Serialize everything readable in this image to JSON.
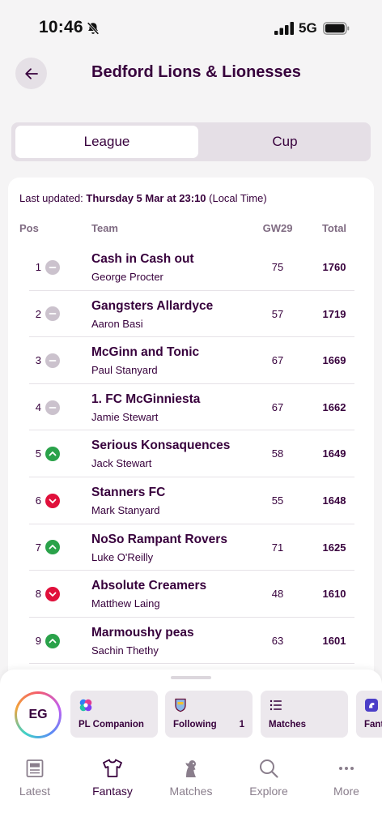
{
  "status_bar": {
    "time": "10:46",
    "network": "5G"
  },
  "header": {
    "title": "Bedford Lions & Lionesses"
  },
  "segment": {
    "league_label": "League",
    "cup_label": "Cup",
    "selected": "League"
  },
  "updated": {
    "prefix": "Last updated: ",
    "datetime": "Thursday 5 Mar at 23:10",
    "suffix": " (Local Time)"
  },
  "table": {
    "columns": {
      "pos": "Pos",
      "team": "Team",
      "gw": "GW29",
      "total": "Total"
    },
    "rows": [
      {
        "pos": "1",
        "movement": "same",
        "team": "Cash in Cash out",
        "manager": "George Procter",
        "gw": "75",
        "total": "1760"
      },
      {
        "pos": "2",
        "movement": "same",
        "team": "Gangsters Allardyce",
        "manager": "Aaron Basi",
        "gw": "57",
        "total": "1719"
      },
      {
        "pos": "3",
        "movement": "same",
        "team": "McGinn and Tonic",
        "manager": "Paul Stanyard",
        "gw": "67",
        "total": "1669"
      },
      {
        "pos": "4",
        "movement": "same",
        "team": "1. FC McGinniesta",
        "manager": "Jamie Stewart",
        "gw": "67",
        "total": "1662"
      },
      {
        "pos": "5",
        "movement": "up",
        "team": "Serious Konsaquences",
        "manager": "Jack Stewart",
        "gw": "58",
        "total": "1649"
      },
      {
        "pos": "6",
        "movement": "down",
        "team": "Stanners FC",
        "manager": "Mark Stanyard",
        "gw": "55",
        "total": "1648"
      },
      {
        "pos": "7",
        "movement": "up",
        "team": "NoSo Rampant Rovers",
        "manager": "Luke O'Reilly",
        "gw": "71",
        "total": "1625"
      },
      {
        "pos": "8",
        "movement": "down",
        "team": "Absolute Creamers",
        "manager": "Matthew Laing",
        "gw": "48",
        "total": "1610"
      },
      {
        "pos": "9",
        "movement": "up",
        "team": "Marmoushy peas",
        "manager": "Sachin Thethy",
        "gw": "63",
        "total": "1601"
      }
    ]
  },
  "drawer": {
    "avatar_initials": "EG",
    "cards": [
      {
        "label": "PL Companion",
        "icon": "pl-companion-icon",
        "badge": ""
      },
      {
        "label": "Following",
        "icon": "club-crest-icon",
        "badge": "1"
      },
      {
        "label": "Matches",
        "icon": "list-icon",
        "badge": ""
      },
      {
        "label": "Fant",
        "icon": "fantasy-icon",
        "badge": ""
      }
    ]
  },
  "tabbar": {
    "items": [
      {
        "label": "Latest",
        "icon": "newspaper-icon"
      },
      {
        "label": "Fantasy",
        "icon": "shirt-icon"
      },
      {
        "label": "Matches",
        "icon": "lion-icon"
      },
      {
        "label": "Explore",
        "icon": "search-icon"
      },
      {
        "label": "More",
        "icon": "more-icon"
      }
    ],
    "active": "Fantasy"
  },
  "colors": {
    "primary": "#37003c",
    "up": "#2aa24a",
    "down": "#e0103b",
    "same": "#cbc2cd"
  }
}
